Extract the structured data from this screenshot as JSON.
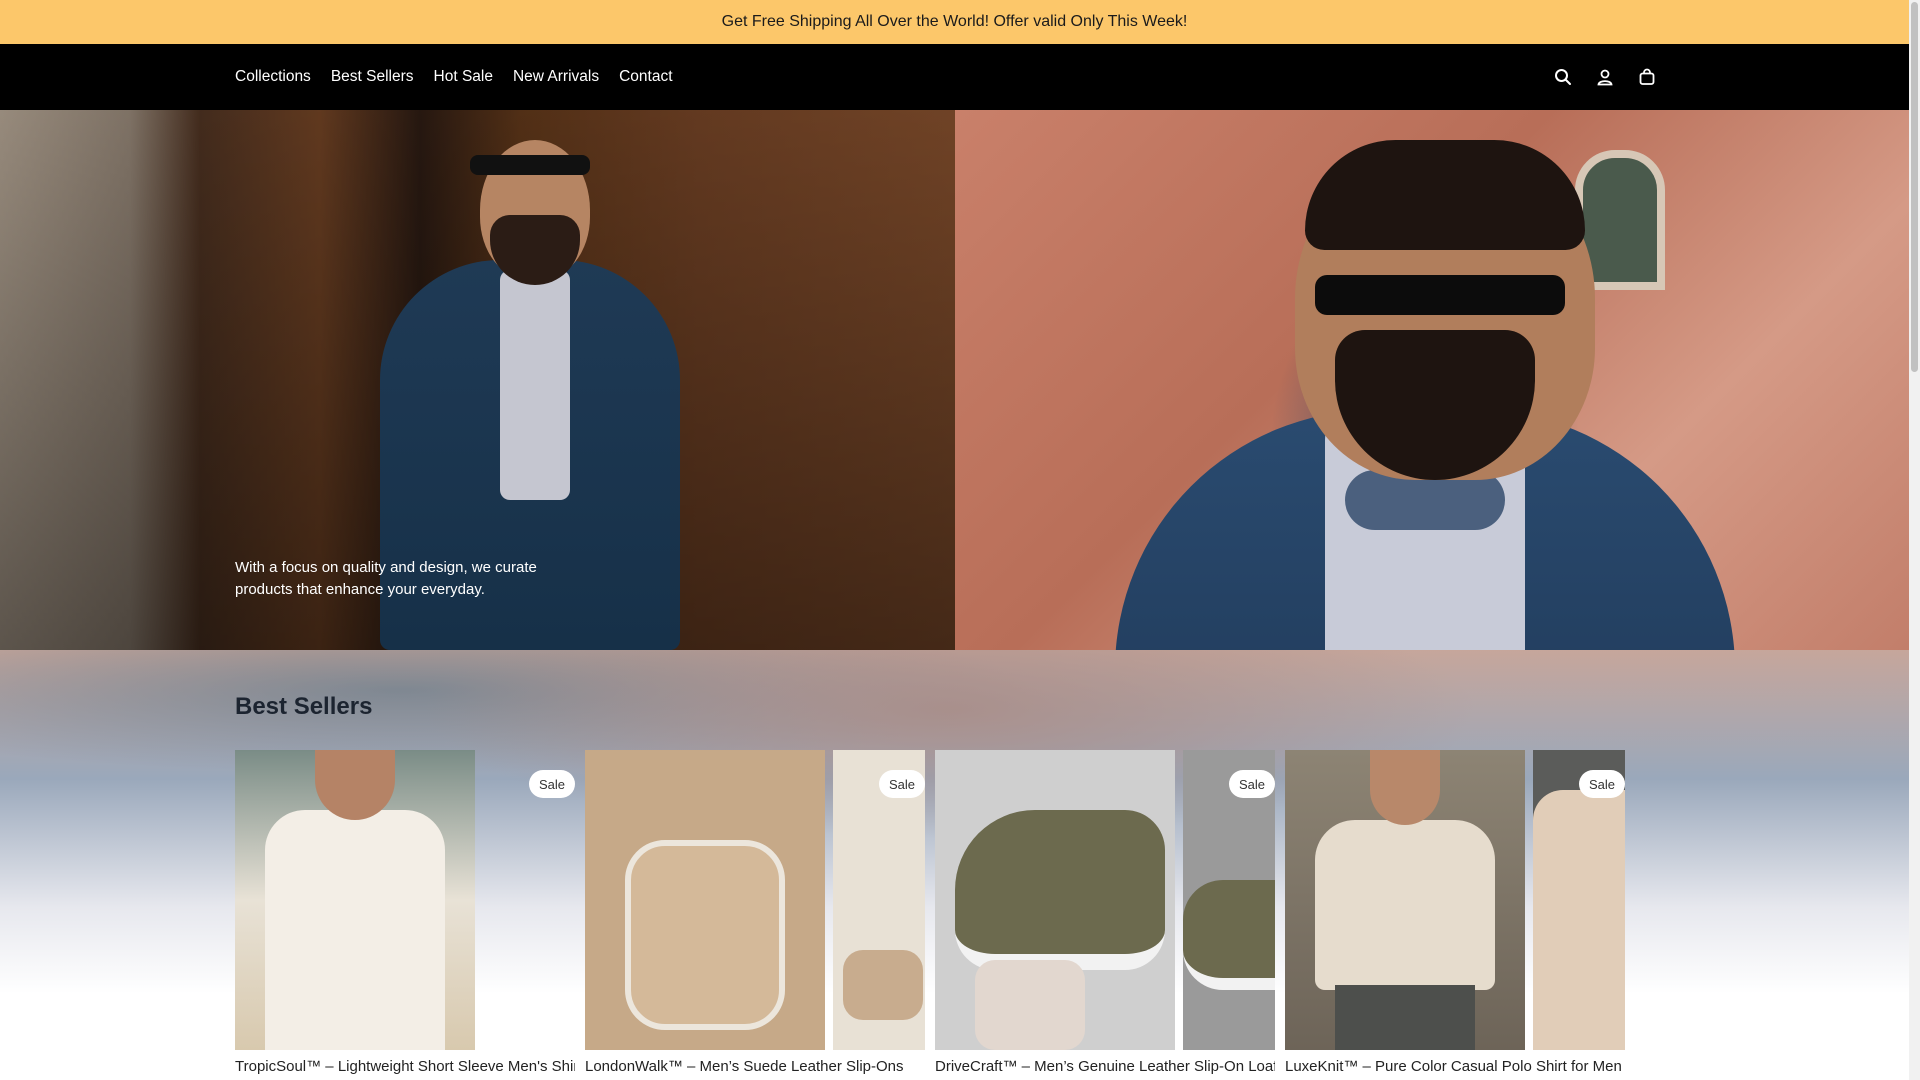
{
  "announcement": {
    "text": "Get Free Shipping All Over the World! Offer valid Only This Week!"
  },
  "nav": {
    "items": [
      {
        "label": "Collections"
      },
      {
        "label": "Best Sellers"
      },
      {
        "label": "Hot Sale"
      },
      {
        "label": "New Arrivals"
      },
      {
        "label": "Contact"
      }
    ]
  },
  "header_icons": [
    "search-icon",
    "account-icon",
    "cart-icon"
  ],
  "hero": {
    "text": "With a focus on quality and design, we curate products that enhance your everyday."
  },
  "bestsellers": {
    "title": "Best Sellers",
    "products": [
      {
        "title": "TropicSoul™ – Lightweight Short Sleeve Men's Shirt",
        "badge": "Sale"
      },
      {
        "title": "LondonWalk™ – Men’s Suede Leather Slip-Ons",
        "badge": "Sale"
      },
      {
        "title": "DriveCraft™ – Men’s Genuine Leather Slip-On Loafers",
        "badge": "Sale"
      },
      {
        "title": "LuxeKnit™ – Pure Color Casual Polo Shirt for Men",
        "badge": "Sale"
      }
    ]
  },
  "colors": {
    "announcement_bg": "#fcc76a",
    "header_bg": "#000000",
    "badge_bg": "#ffffff"
  }
}
